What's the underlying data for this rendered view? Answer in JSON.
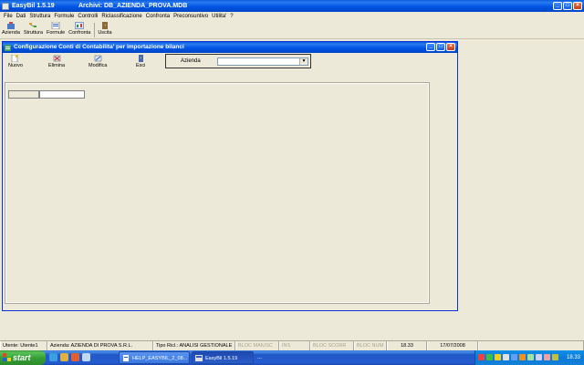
{
  "app": {
    "title": "EasyBil   1.5.19",
    "db_label": "Archivi: DB_AZIENDA_PROVA.MDB"
  },
  "menu": [
    "File",
    "Dati",
    "Struttura",
    "Formule",
    "Controlli",
    "Riclassificazione",
    "Confronta",
    "Preconsuntivo",
    "Utilita'",
    "?"
  ],
  "toolbar": {
    "items": [
      "Azienda",
      "Struttura",
      "Formule",
      "Confronta",
      "Uscita"
    ]
  },
  "child": {
    "title": "Configurazione Conti di Contabilita' per importazione bilanci",
    "buttons": [
      "Nuovo",
      "Elimina",
      "Modifica",
      "Esci"
    ],
    "azienda_label": "Azienda",
    "azienda_value": ""
  },
  "status": {
    "utente": "Utente: Utente1",
    "azienda": "Azienda: AZIENDA DI PROVA S.R.L.",
    "tipo": "Tipo Ricl.: ANALISI GESTIONALE",
    "maiusc": "BLOC MAIUSC",
    "ins": "INS",
    "scorr": "BLOC SCORR",
    "num": "BLOC NUM",
    "time": "18.33",
    "date": "17/07/2008"
  },
  "taskbar": {
    "start": "start",
    "tasks": [
      "HELP_EASYBIL_2_08...",
      "EasyBil   1.5.19"
    ],
    "more": "...",
    "clock": "18.33"
  },
  "colors": {
    "xp_blue": "#0055e5",
    "face": "#ece9d8",
    "start_green": "#36a036"
  }
}
